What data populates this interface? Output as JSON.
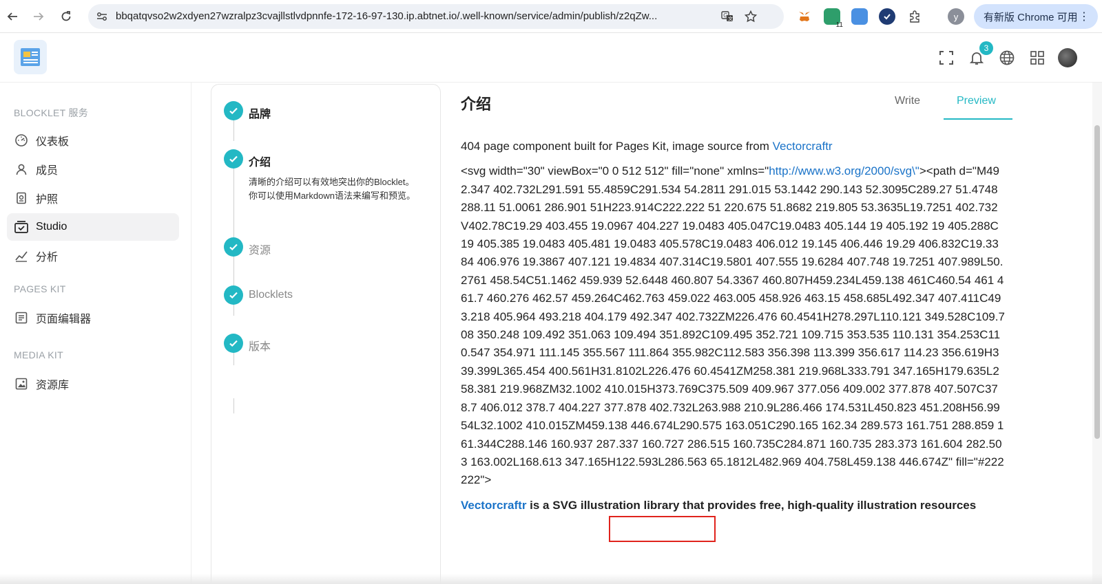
{
  "browser": {
    "url": "bbqatqvso2w2xdyen27wzralpz3cvajllstlvdpnnfe-172-16-97-130.ip.abtnet.io/.well-known/service/admin/publish/z2qZw...",
    "extension_badge": "11",
    "profile_initial": "y",
    "update_label": "有新版 Chrome 可用"
  },
  "header": {
    "notification_count": "3"
  },
  "sidebar": {
    "sections": [
      {
        "title": "BLOCKLET 服务",
        "items": [
          {
            "label": "仪表板",
            "icon": "dashboard-icon"
          },
          {
            "label": "成员",
            "icon": "user-icon"
          },
          {
            "label": "护照",
            "icon": "passport-icon"
          },
          {
            "label": "Studio",
            "icon": "studio-icon",
            "active": true
          },
          {
            "label": "分析",
            "icon": "analytics-icon"
          }
        ]
      },
      {
        "title": "PAGES KIT",
        "items": [
          {
            "label": "页面编辑器",
            "icon": "page-editor-icon"
          }
        ]
      },
      {
        "title": "MEDIA KIT",
        "items": [
          {
            "label": "资源库",
            "icon": "media-library-icon"
          }
        ]
      }
    ]
  },
  "stepper": {
    "steps": [
      {
        "label": "品牌",
        "state": "done"
      },
      {
        "label": "介绍",
        "state": "current",
        "description": "清晰的介绍可以有效地突出你的Blocklet。你可以使用Markdown语法来编写和预览。"
      },
      {
        "label": "资源",
        "state": "done"
      },
      {
        "label": "Blocklets",
        "state": "done"
      },
      {
        "label": "版本",
        "state": "done"
      }
    ]
  },
  "main": {
    "title": "介绍",
    "tabs": [
      {
        "label": "Write",
        "active": false
      },
      {
        "label": "Preview",
        "active": true
      }
    ],
    "preview": {
      "intro_text": "404 page component built for Pages Kit, image source from ",
      "intro_link": "Vectorcraftr",
      "svg_prefix": "<svg width=\"30\" viewBox=\"0 0 512 512\" fill=\"none\" xmlns=\"",
      "svg_link": "http://www.w3.org/2000/svg\\\"",
      "svg_body": "><path d=\"M492.347 402.732L291.591 55.4859C291.534 54.2811 291.015 53.1442 290.143 52.3095C289.27 51.4748 288.11 51.0061 286.901 51H223.914C222.222 51 220.675 51.8682 219.805 53.3635L19.7251 402.732V402.78C19.29 403.455 19.0967 404.227 19.0483 405.047C19.0483 405.144 19 405.192 19 405.288C19 405.385 19.0483 405.481 19.0483 405.578C19.0483 406.012 19.145 406.446 19.29 406.832C19.3384 406.976 19.3867 407.121 19.4834 407.314C19.5801 407.555 19.6284 407.748 19.7251 407.989L50.2761 458.54C51.1462 459.939 52.6448 460.807 54.3367 460.807H459.234L459.138 461C460.54 461 461.7 460.276 462.57 459.264C462.763 459.022 463.005 458.926 463.15 458.685L492.347 407.411C493.218 405.964 493.218 404.179 492.347 402.732ZM226.476 60.4541H278.297L110.121 349.528C109.708 350.248 109.492 351.063 109.494 351.892C109.495 352.721 109.715 353.535 110.131 354.253C110.547 354.971 111.145 355.567 111.864 355.982C112.583 356.398 113.399 356.617 114.23 356.619H339.399L365.454 400.561H31.8102L226.476 60.4541ZM258.381 219.968L333.791 347.165H179.635L258.381 219.968ZM32.1002 410.015H373.769C375.509 409.967 377.056 409.002 377.878 407.507C378.7 406.012 378.7 404.227 377.878 402.732L263.988 210.9L286.466 174.531L450.823 451.208H56.9954L32.1002 410.015ZM459.138 446.674L290.575 163.051C290.165 162.34 289.573 161.751 288.859 161.344C288.146 160.937 287.337 160.727 286.515 160.735C284.871 160.735 283.373 161.604 282.503 163.002L168.613 347.165H122.593L286.563 65.1812L482.969 404.758L459.138 446.674Z\" fill=\"#222222\">",
      "footer_link": "Vectorcraftr",
      "footer_text": " is a SVG illustration library that provides free, high-quality illustration resources"
    }
  }
}
